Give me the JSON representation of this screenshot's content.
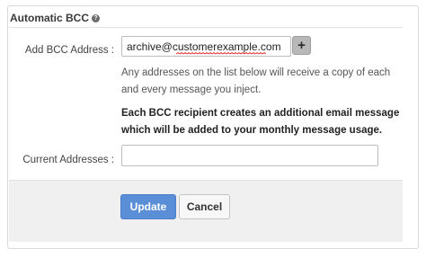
{
  "section": {
    "title": "Automatic BCC",
    "help_icon": "question-circle-icon"
  },
  "form": {
    "add_bcc_label": "Add BCC Address :",
    "add_bcc_value": "archive@customerexample.com",
    "add_button_label": "+",
    "help_text": "Any addresses on the list below will receive a copy of each and every message you inject.",
    "warning_text": "Each BCC recipient creates an additional email message which will be added to your monthly message usage.",
    "current_addresses_label": "Current Addresses :",
    "current_addresses_value": ""
  },
  "actions": {
    "update_label": "Update",
    "cancel_label": "Cancel"
  },
  "colors": {
    "primary_button": "#5a8fd8",
    "footer_background": "#f0f0f0"
  }
}
